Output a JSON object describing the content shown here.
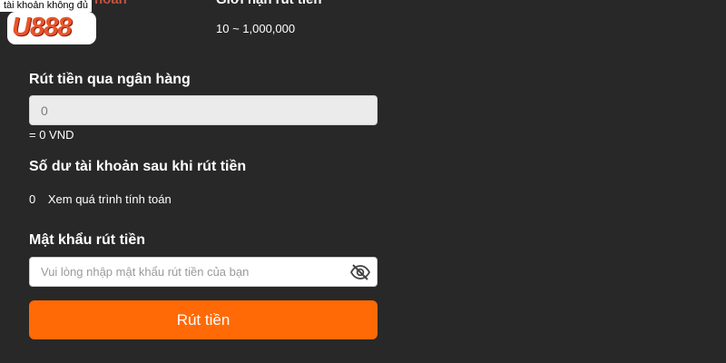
{
  "header": {
    "left_title_cut": "hoản",
    "limit_title_cut": "Giới hạn rút tiền",
    "limit_value": "10 ~ 1,000,000"
  },
  "logo": {
    "caption": "tài khoản không đủ",
    "brand": "U888"
  },
  "bank_withdraw": {
    "label": "Rút tiền qua ngân hàng",
    "amount_value": "0",
    "converted": "= 0 VND"
  },
  "balance": {
    "label": "Số dư tài khoản sau khi rút tiền",
    "value": "0",
    "link": "Xem quá trình tính toán"
  },
  "password": {
    "label": "Mật khẩu rút tiền",
    "placeholder": "Vui lòng nhập mật khẩu rút tiền của bạn",
    "toggle_icon": "eye-slash-icon"
  },
  "submit_label": "Rút tiền",
  "colors": {
    "background": "#282828",
    "accent": "#ff6a06"
  }
}
